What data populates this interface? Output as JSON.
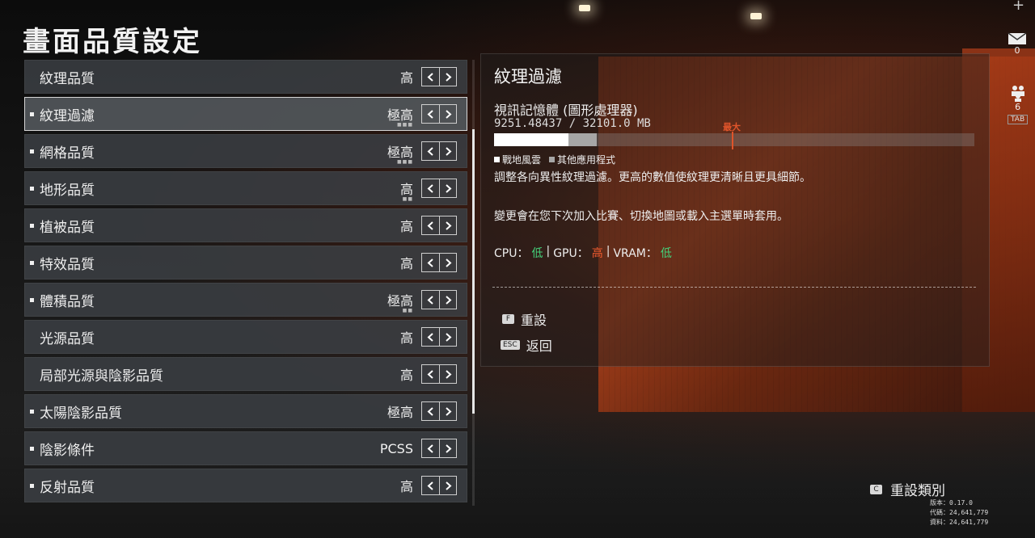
{
  "title": "畫面品質設定",
  "settings": [
    {
      "label": "紋理品質",
      "value": "高",
      "marked": false,
      "dots": ""
    },
    {
      "label": "紋理過濾",
      "value": "極高",
      "marked": true,
      "dots": "■■■",
      "selected": true
    },
    {
      "label": "網格品質",
      "value": "極高",
      "marked": true,
      "dots": "■■■"
    },
    {
      "label": "地形品質",
      "value": "高",
      "marked": true,
      "dots": "■■"
    },
    {
      "label": "植被品質",
      "value": "高",
      "marked": true,
      "dots": ""
    },
    {
      "label": "特效品質",
      "value": "高",
      "marked": true,
      "dots": ""
    },
    {
      "label": "體積品質",
      "value": "極高",
      "marked": true,
      "dots": "■■"
    },
    {
      "label": "光源品質",
      "value": "高",
      "marked": false,
      "dots": ""
    },
    {
      "label": "局部光源與陰影品質",
      "value": "高",
      "marked": false,
      "dots": ""
    },
    {
      "label": "太陽陰影品質",
      "value": "極高",
      "marked": true,
      "dots": ""
    },
    {
      "label": "陰影條件",
      "value": "PCSS",
      "marked": true,
      "dots": ""
    },
    {
      "label": "反射品質",
      "value": "高",
      "marked": true,
      "dots": ""
    }
  ],
  "detail": {
    "title": "紋理過濾",
    "vram_title": "視訊記憶體 (圖形處理器)",
    "vram_value": "9251.48437 / 32101.0 MB",
    "max_label": "最大",
    "bar": {
      "game_fraction": 0.155,
      "other_fraction": 0.058,
      "max_fraction": 0.495,
      "game_color": "#ffffff",
      "other_color": "#a6a6a6",
      "max_color": "#e0542a"
    },
    "legend_game": "戰地風雲",
    "legend_other": "其他應用程式",
    "description": "調整各向異性紋理過濾。更高的數值使紋理更清晰且更具細節。",
    "note": "變更會在您下次加入比賽、切換地圖或載入主選單時套用。",
    "perf": {
      "cpu_label": "CPU：",
      "cpu_value": "低",
      "gpu_label": "GPU：",
      "gpu_value": "高",
      "vram_label": "VRAM：",
      "vram_value": "低",
      "separator": "|"
    },
    "reset": {
      "key": "F",
      "label": "重設"
    },
    "back": {
      "key": "ESC",
      "label": "返回"
    }
  },
  "rail": {
    "plus": "+",
    "mail_count": "0",
    "squad_count": "6",
    "tab_key": "TAB",
    "mail_icon": "mail-icon",
    "squad_icon": "squad-icon"
  },
  "reset_category": {
    "key": "C",
    "label": "重設類別"
  },
  "version": {
    "version_label": "版本：",
    "version_value": "0.17.0",
    "code_label": "代碼：",
    "code_value": "24,641,779",
    "data_label": "資料：",
    "data_value": "24,641,779"
  }
}
